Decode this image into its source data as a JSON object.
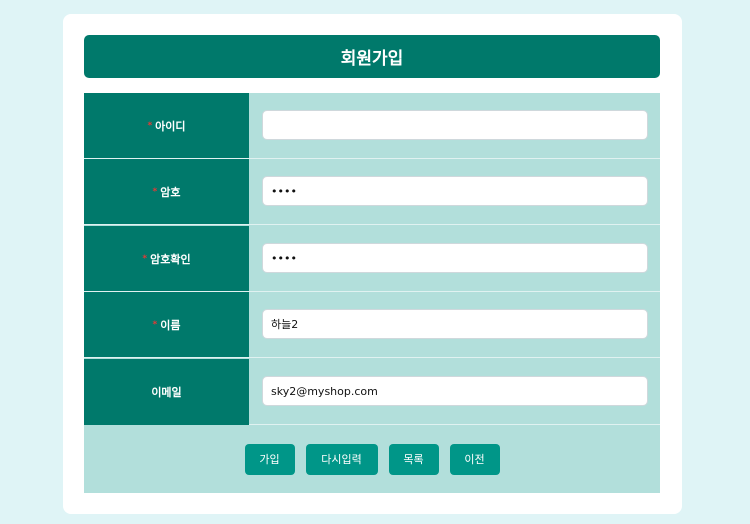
{
  "form": {
    "title": "회원가입",
    "required_mark": "*",
    "fields": [
      {
        "label": "아이디",
        "required": true,
        "type": "text",
        "value": ""
      },
      {
        "label": "암호",
        "required": true,
        "type": "password",
        "value": "1234"
      },
      {
        "label": "암호확인",
        "required": true,
        "type": "password",
        "value": "1234"
      },
      {
        "label": "이름",
        "required": true,
        "type": "text",
        "value": "하늘2"
      },
      {
        "label": "이메일",
        "required": false,
        "type": "text",
        "value": "sky2@myshop.com"
      }
    ],
    "buttons": {
      "submit": "가입",
      "reset": "다시입력",
      "list": "목록",
      "back": "이전"
    }
  },
  "colors": {
    "page_bg": "#dff4f6",
    "primary": "#00796b",
    "table_bg": "#b2dfdb",
    "button": "#009688",
    "required": "#e53935"
  }
}
